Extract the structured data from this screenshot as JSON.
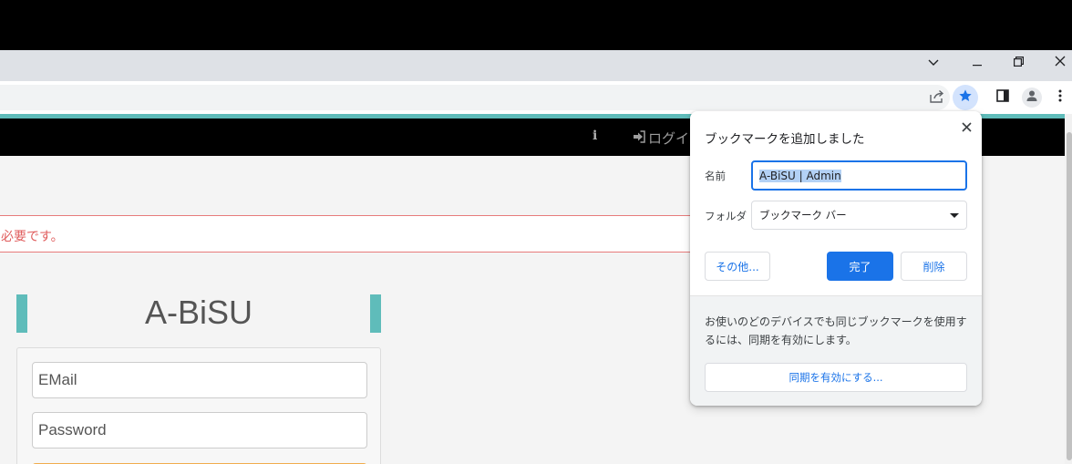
{
  "browser": {
    "window_controls": {
      "tab_search": "tab-search",
      "minimize": "minimize",
      "restore": "restore",
      "close": "close"
    }
  },
  "page": {
    "navbar": {
      "info_icon": "i",
      "login_label": "ログイン"
    },
    "alert": {
      "message": "必要です。"
    },
    "brand": {
      "title": "A-BiSU"
    },
    "login_form": {
      "email_placeholder": "EMail",
      "password_placeholder": "Password"
    }
  },
  "bookmark_popup": {
    "title": "ブックマークを追加しました",
    "name_label": "名前",
    "name_value": "A-BiSU | Admin",
    "folder_label": "フォルダ",
    "folder_value": "ブックマーク バー",
    "more_button": "その他...",
    "done_button": "完了",
    "remove_button": "削除",
    "sync_message": "お使いのどのデバイスでも同じブックマークを使用するには、同期を有効にします。",
    "sync_button": "同期を有効にする..."
  },
  "colors": {
    "accent_blue": "#1a73e8",
    "brand_teal": "#5fbcba",
    "alert_red": "#e05c5c"
  }
}
